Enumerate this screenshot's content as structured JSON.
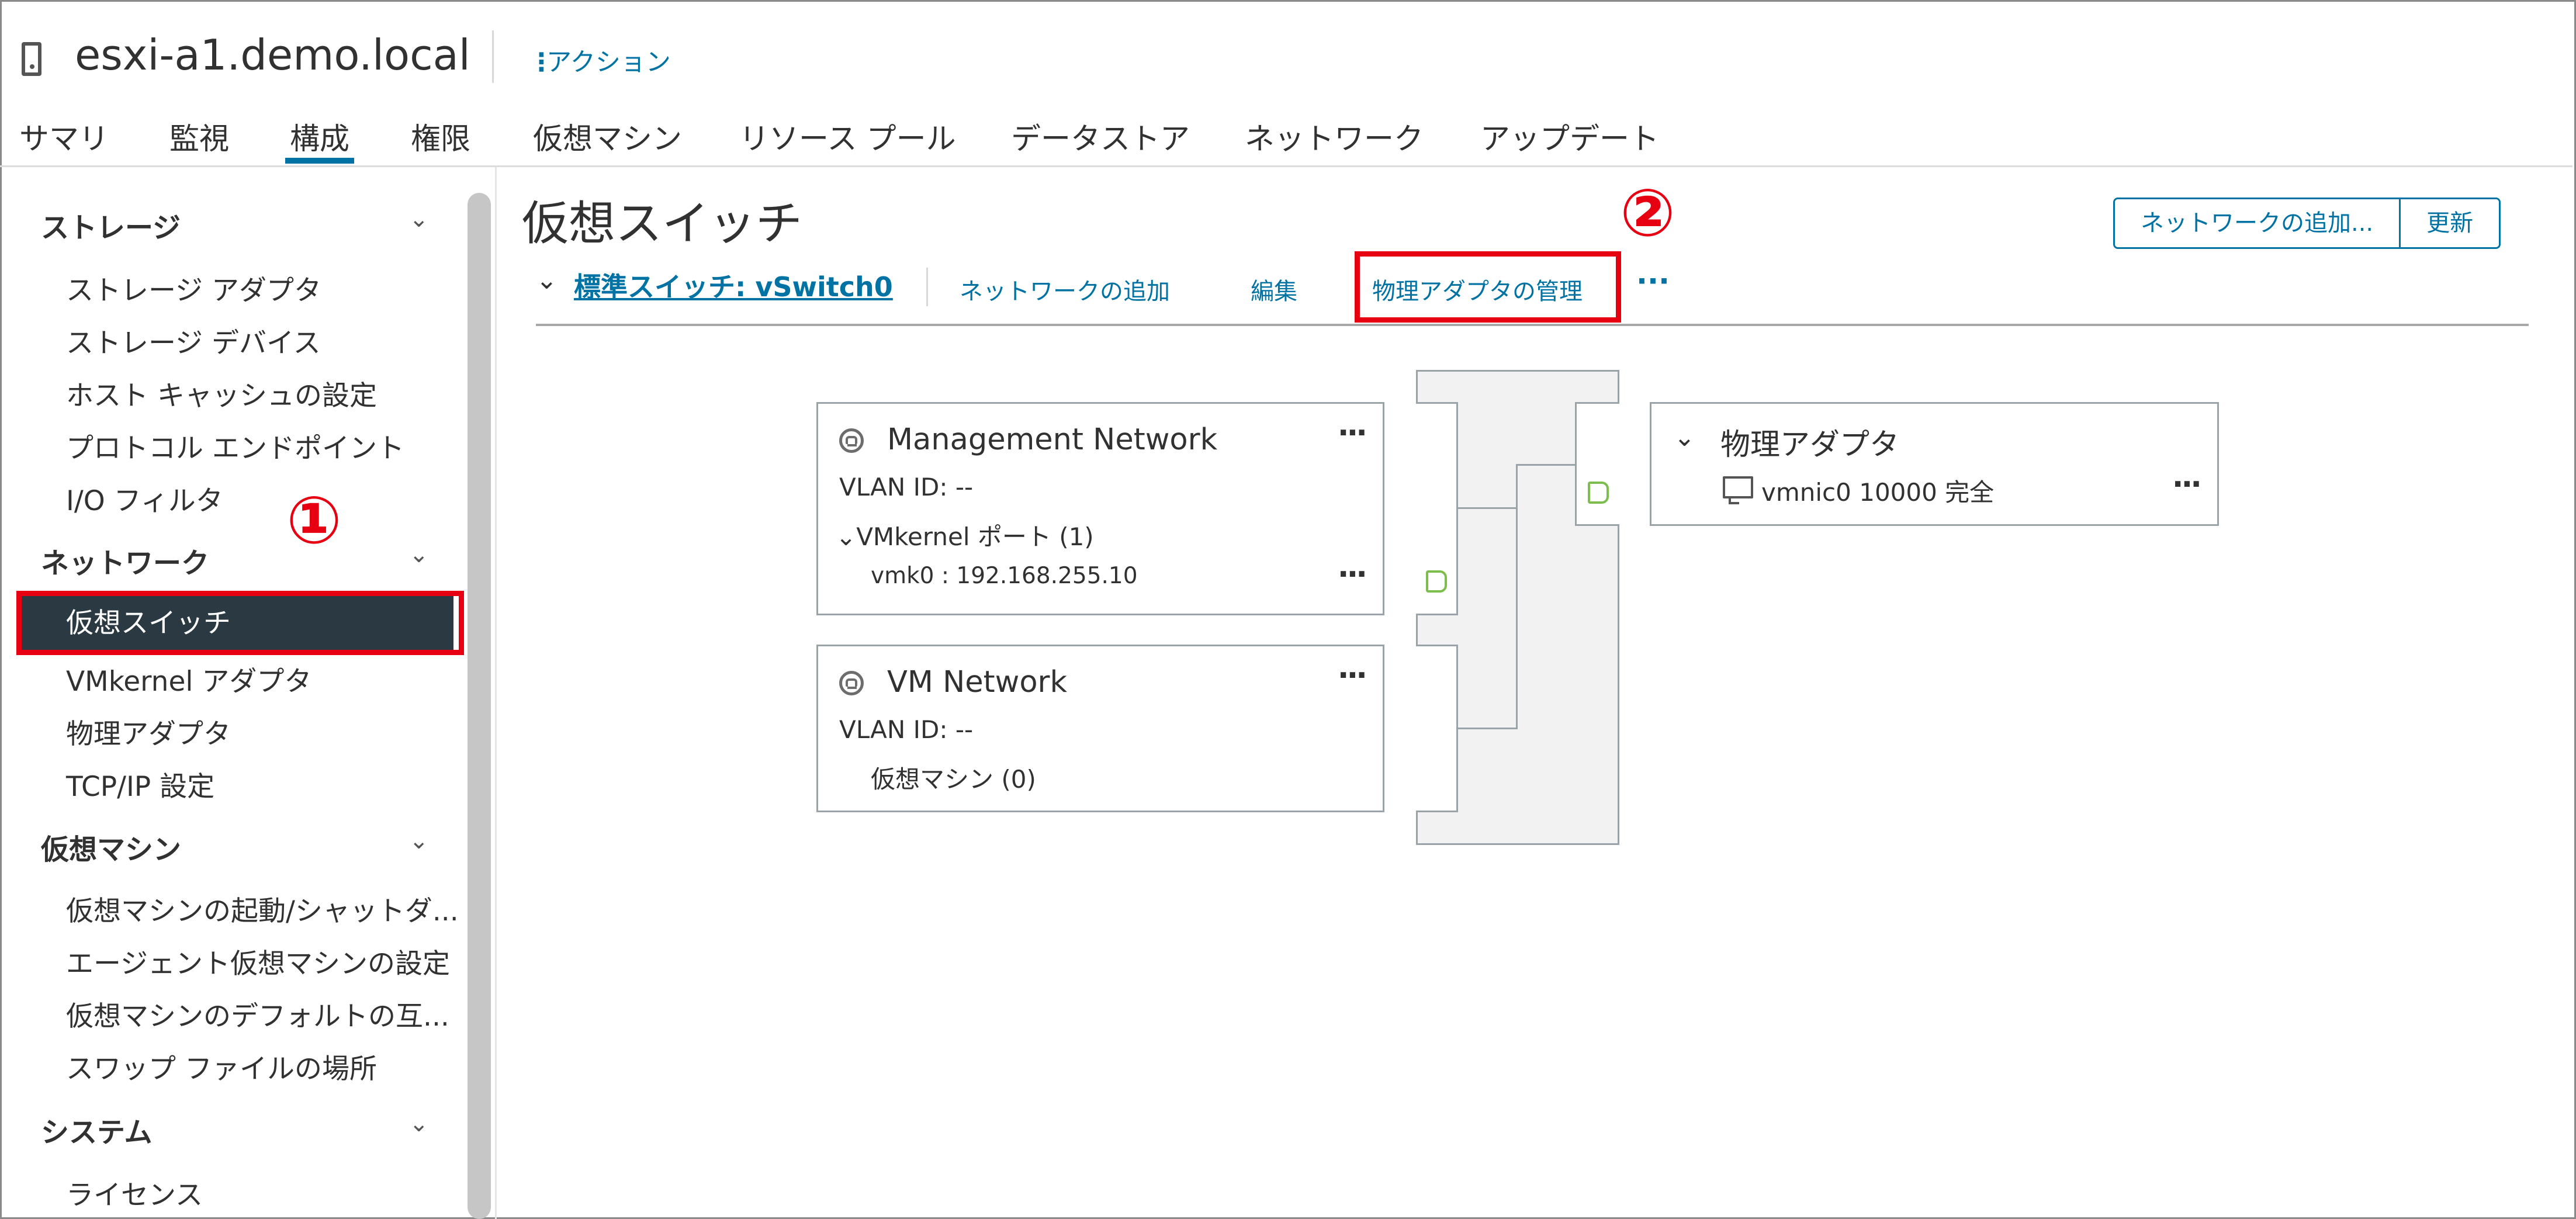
{
  "header": {
    "host_name": "esxi-a1.demo.local",
    "actions_label": "アクション",
    "host_icon": "host-server-icon"
  },
  "tabs": [
    {
      "label": "サマリ"
    },
    {
      "label": "監視"
    },
    {
      "label": "構成",
      "active": true
    },
    {
      "label": "権限"
    },
    {
      "label": "仮想マシン"
    },
    {
      "label": "リソース プール"
    },
    {
      "label": "データストア"
    },
    {
      "label": "ネットワーク"
    },
    {
      "label": "アップデート"
    }
  ],
  "sidebar": {
    "sections": [
      {
        "title": "ストレージ",
        "items": [
          "ストレージ アダプタ",
          "ストレージ デバイス",
          "ホスト キャッシュの設定",
          "プロトコル エンドポイント",
          "I/O フィルタ"
        ]
      },
      {
        "title": "ネットワーク",
        "items": [
          "仮想スイッチ",
          "VMkernel アダプタ",
          "物理アダプタ",
          "TCP/IP 設定"
        ]
      },
      {
        "title": "仮想マシン",
        "items": [
          "仮想マシンの起動/シャットダ...",
          "エージェント仮想マシンの設定",
          "仮想マシンのデフォルトの互...",
          "スワップ ファイルの場所"
        ]
      },
      {
        "title": "システム",
        "items": [
          "ライセンス"
        ]
      }
    ],
    "selected_item": "仮想スイッチ"
  },
  "annotations": {
    "marker_1": "①",
    "marker_2": "②",
    "highlight_color": "#e60012"
  },
  "main": {
    "title": "仮想スイッチ",
    "add_network_button": "ネットワークの追加...",
    "refresh_button": "更新",
    "switch": {
      "name": "標準スイッチ: vSwitch0",
      "add_network_link": "ネットワークの追加",
      "edit_link": "編集",
      "manage_adapters_link": "物理アダプタの管理",
      "more": "···"
    },
    "port_groups": [
      {
        "name": "Management Network",
        "vlan": "VLAN ID: --",
        "sub_label": "VMkernel ポート (1)",
        "sub_item": "vmk0 : 192.168.255.10"
      },
      {
        "name": "VM Network",
        "vlan": "VLAN ID: --",
        "sub_label": "仮想マシン (0)"
      }
    ],
    "physical_adapters": {
      "title": "物理アダプタ",
      "nic": "vmnic0 10000 完全"
    }
  },
  "colors": {
    "accent": "#0072a3",
    "selected_bg": "#2b3a42",
    "nic_green": "#7cbd4e"
  }
}
